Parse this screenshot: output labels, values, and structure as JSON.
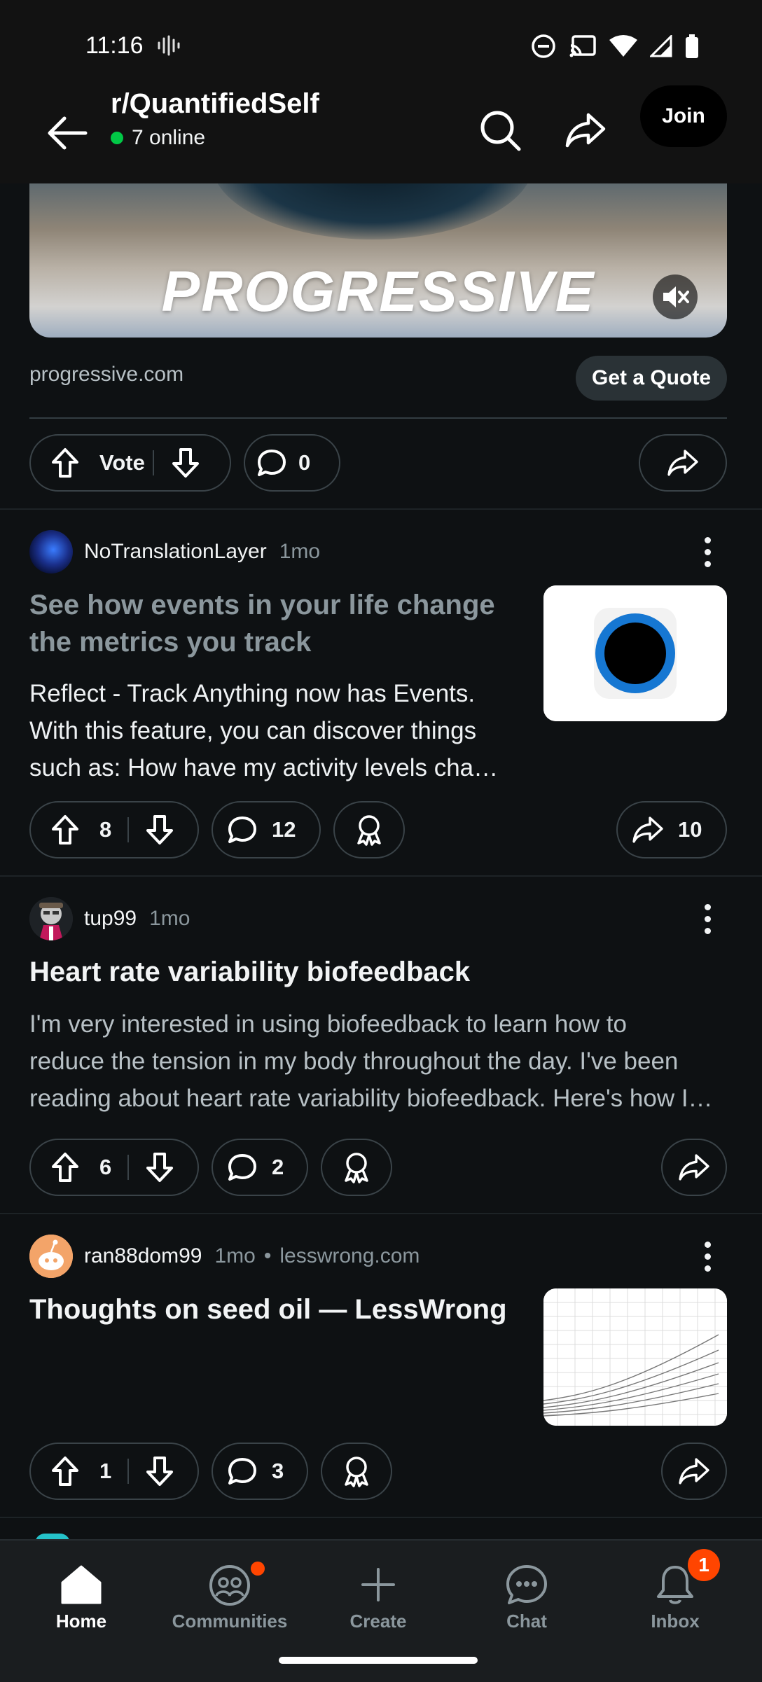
{
  "status": {
    "time": "11:16"
  },
  "header": {
    "subreddit": "r/QuantifiedSelf",
    "online": "7 online",
    "join": "Join"
  },
  "ad": {
    "logo_text": "PROGRESSIVE",
    "domain": "progressive.com",
    "cta": "Get a Quote",
    "vote_label": "Vote",
    "comments": "0"
  },
  "posts": [
    {
      "author": "NoTranslationLayer",
      "age": "1mo",
      "title": "See how events in your life change the metrics you track",
      "body_lines": [
        "Reflect - Track Anything now has Events.",
        "With this feature, you can discover things",
        "such as: How have my activity levels cha…"
      ],
      "votes": "8",
      "comments": "12",
      "shares": "10"
    },
    {
      "author": "tup99",
      "age": "1mo",
      "title": "Heart rate variability biofeedback",
      "body_lines": [
        "I'm very interested in using biofeedback to learn how to",
        "reduce the tension in my body throughout the day. I've been",
        "reading about heart rate variability biofeedback. Here's how I…"
      ],
      "votes": "6",
      "comments": "2"
    },
    {
      "author": "ran88dom99",
      "age": "1mo",
      "domain": "lesswrong.com",
      "title": "Thoughts on seed oil — LessWrong",
      "votes": "1",
      "comments": "3"
    }
  ],
  "tabs": {
    "home": "Home",
    "communities": "Communities",
    "create": "Create",
    "chat": "Chat",
    "inbox": "Inbox",
    "inbox_badge": "1"
  }
}
